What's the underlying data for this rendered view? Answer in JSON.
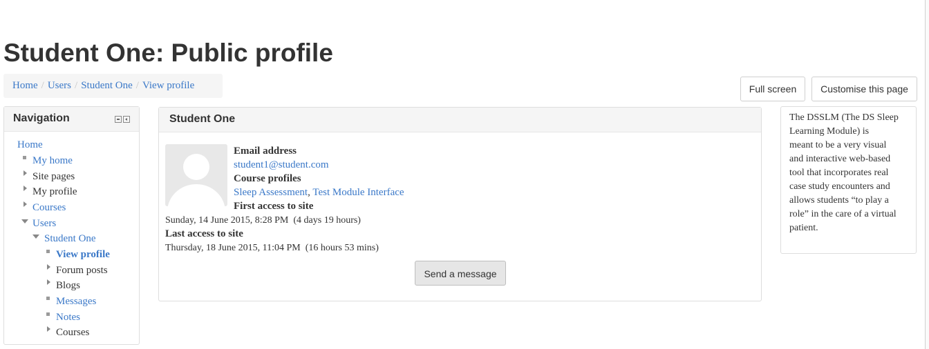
{
  "page": {
    "title": "Student One: Public profile"
  },
  "breadcrumb": {
    "items": [
      "Home",
      "Users",
      "Student One",
      "View profile"
    ],
    "separator": "/"
  },
  "toolbar": {
    "fullscreen_label": "Full screen",
    "customise_label": "Customise this page"
  },
  "navigation": {
    "title": "Navigation",
    "items": [
      {
        "label": "Home",
        "link": true,
        "icon": "none"
      },
      {
        "label": "My home",
        "link": true,
        "icon": "bullet"
      },
      {
        "label": "Site pages",
        "link": false,
        "icon": "collapsed"
      },
      {
        "label": "My profile",
        "link": false,
        "icon": "collapsed"
      },
      {
        "label": "Courses",
        "link": true,
        "icon": "collapsed"
      },
      {
        "label": "Users",
        "link": true,
        "icon": "expanded"
      },
      {
        "label": "Student One",
        "link": true,
        "icon": "expanded"
      },
      {
        "label": "View profile",
        "link": true,
        "icon": "bullet",
        "active": true
      },
      {
        "label": "Forum posts",
        "link": false,
        "icon": "collapsed"
      },
      {
        "label": "Blogs",
        "link": false,
        "icon": "collapsed"
      },
      {
        "label": "Messages",
        "link": true,
        "icon": "bullet"
      },
      {
        "label": "Notes",
        "link": true,
        "icon": "bullet"
      },
      {
        "label": "Courses",
        "link": false,
        "icon": "collapsed"
      }
    ]
  },
  "profile": {
    "name": "Student One",
    "email_label": "Email address",
    "email": "student1@student.com",
    "course_profiles_label": "Course profiles",
    "course_profiles": [
      "Sleep Assessment",
      "Test Module Interface"
    ],
    "first_access_label": "First access to site",
    "first_access_value": "Sunday, 14 June 2015, 8:28 PM  (4 days 19 hours)",
    "last_access_label": "Last access to site",
    "last_access_value": "Thursday, 18 June 2015, 11:04 PM  (16 hours 53 mins)",
    "send_message_label": "Send a message"
  },
  "side_block": {
    "lines": [
      "The DSSLM (The DS Sleep",
      "Learning Module) is",
      "meant to be a very visual",
      "and interactive web-based",
      "tool that incorporates real",
      "case study encounters and",
      "allows students “to play a",
      "role” in the care of a virtual",
      "patient."
    ]
  },
  "colors": {
    "link": "#3a78c8",
    "text": "#333333",
    "block_header_bg": "#f5f5f5",
    "border": "#dddddd"
  }
}
